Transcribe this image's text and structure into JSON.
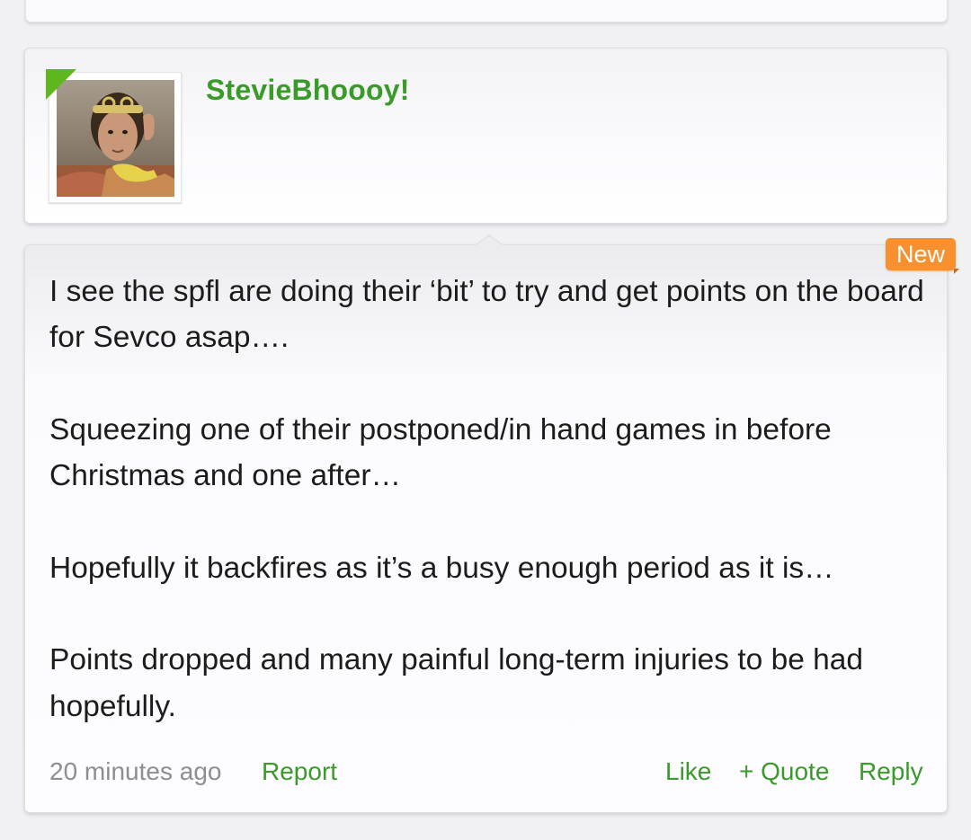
{
  "author": {
    "username": "StevieBhoooy!"
  },
  "post": {
    "badge": "New",
    "paragraphs": [
      "I see the spfl are doing their ‘bit’ to try and get points on the board for Sevco asap….",
      "Squeezing one of their postponed/in hand games in before Christmas and one after…",
      "Hopefully it backfires as it’s a busy enough period as it is…",
      "Points dropped and many painful long-term injuries to be had hopefully."
    ],
    "timestamp": "20 minutes ago",
    "actions": {
      "report": "Report",
      "like": "Like",
      "quote": "+ Quote",
      "reply": "Reply"
    }
  },
  "colors": {
    "accent_green": "#3a9a2a",
    "badge_green": "#5fb71e",
    "new_badge_orange": "#f7902e",
    "meta_gray": "#8d8d92",
    "body_text": "#1c1c1c"
  }
}
